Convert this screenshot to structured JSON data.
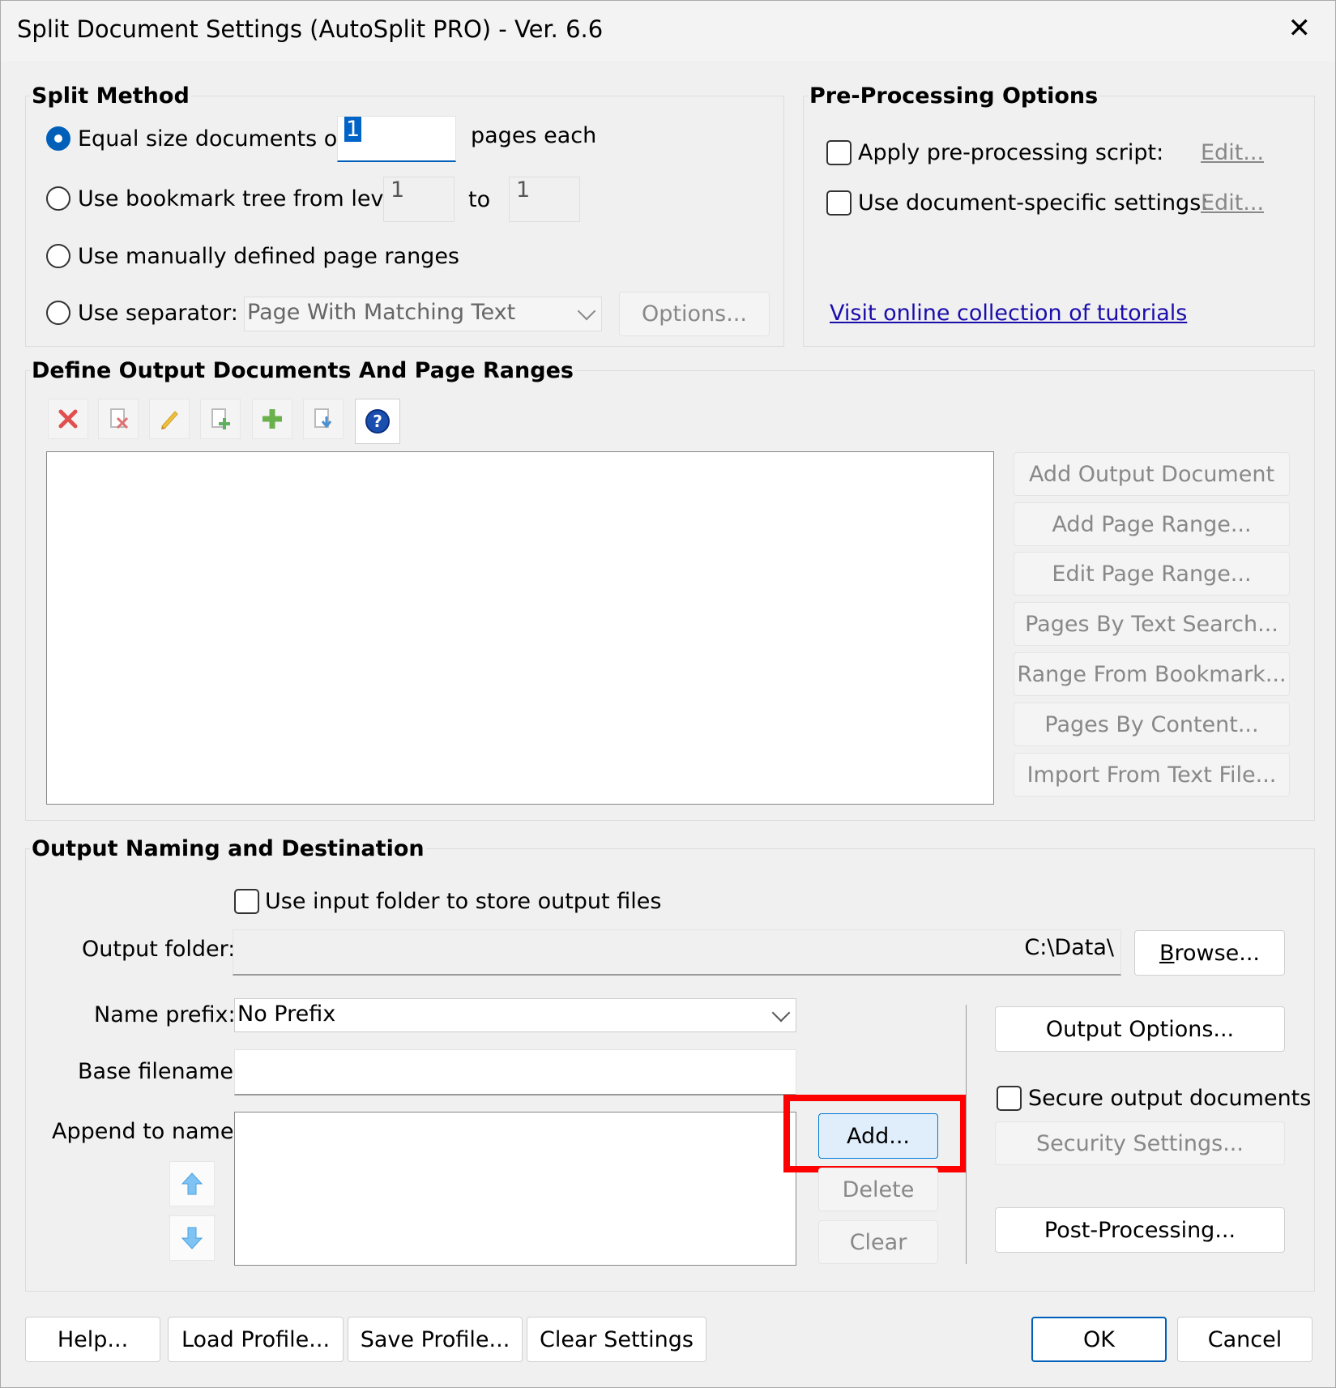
{
  "window": {
    "title": "Split Document Settings (AutoSplit PRO) - Ver. 6.6",
    "close_glyph": "✕"
  },
  "split_method": {
    "title": "Split Method",
    "equal_size_label": "Equal size documents of",
    "equal_size_value": "1",
    "pages_each": "pages each",
    "bookmark_label": "Use bookmark tree from level",
    "bookmark_from": "1",
    "to_label": "to",
    "bookmark_to": "1",
    "manual_label": "Use manually defined page ranges",
    "separator_label": "Use separator:",
    "separator_value": "Page With Matching Text",
    "options_button": "Options..."
  },
  "pre_processing": {
    "title": "Pre-Processing Options",
    "script_label": "Apply pre-processing script:",
    "script_edit": "Edit...",
    "doc_settings_label": "Use document-specific settings:",
    "doc_settings_edit": "Edit...",
    "tutorials_link": "Visit online collection of tutorials"
  },
  "output_docs": {
    "title": "Define Output Documents And Page Ranges",
    "toolbar_icons": [
      "delete-icon",
      "delete-page-icon",
      "edit-icon",
      "add-page-icon",
      "add-icon",
      "import-icon",
      "help-icon"
    ],
    "buttons": {
      "add_output_document": "Add Output Document",
      "add_page_range": "Add Page Range...",
      "edit_page_range": "Edit Page Range...",
      "pages_by_text_search": "Pages By Text Search...",
      "range_from_bookmark": "Range From Bookmark...",
      "pages_by_content": "Pages By Content...",
      "import_from_text_file": "Import From Text File..."
    }
  },
  "output_naming": {
    "title": "Output Naming and Destination",
    "use_input_folder_label": "Use input folder to store output files",
    "output_folder_label": "Output folder:",
    "output_folder_value": "C:\\Data\\",
    "browse_button_prefix": "B",
    "browse_button_rest": "rowse...",
    "name_prefix_label": "Name prefix:",
    "name_prefix_value": "No Prefix",
    "base_filename_label": "Base filename:",
    "base_filename_value": "",
    "append_label": "Append to name:",
    "add_button": "Add...",
    "delete_button": "Delete",
    "clear_button": "Clear",
    "output_options_button": "Output Options...",
    "secure_label": "Secure output documents",
    "security_settings_button": "Security Settings...",
    "post_processing_button": "Post-Processing..."
  },
  "footer": {
    "help": "Help...",
    "load_profile": "Load Profile...",
    "save_profile": "Save Profile...",
    "clear_settings": "Clear Settings",
    "ok": "OK",
    "cancel": "Cancel"
  },
  "colors": {
    "accent": "#005fb8",
    "highlight": "#ff0000",
    "link": "#1a0dab"
  }
}
